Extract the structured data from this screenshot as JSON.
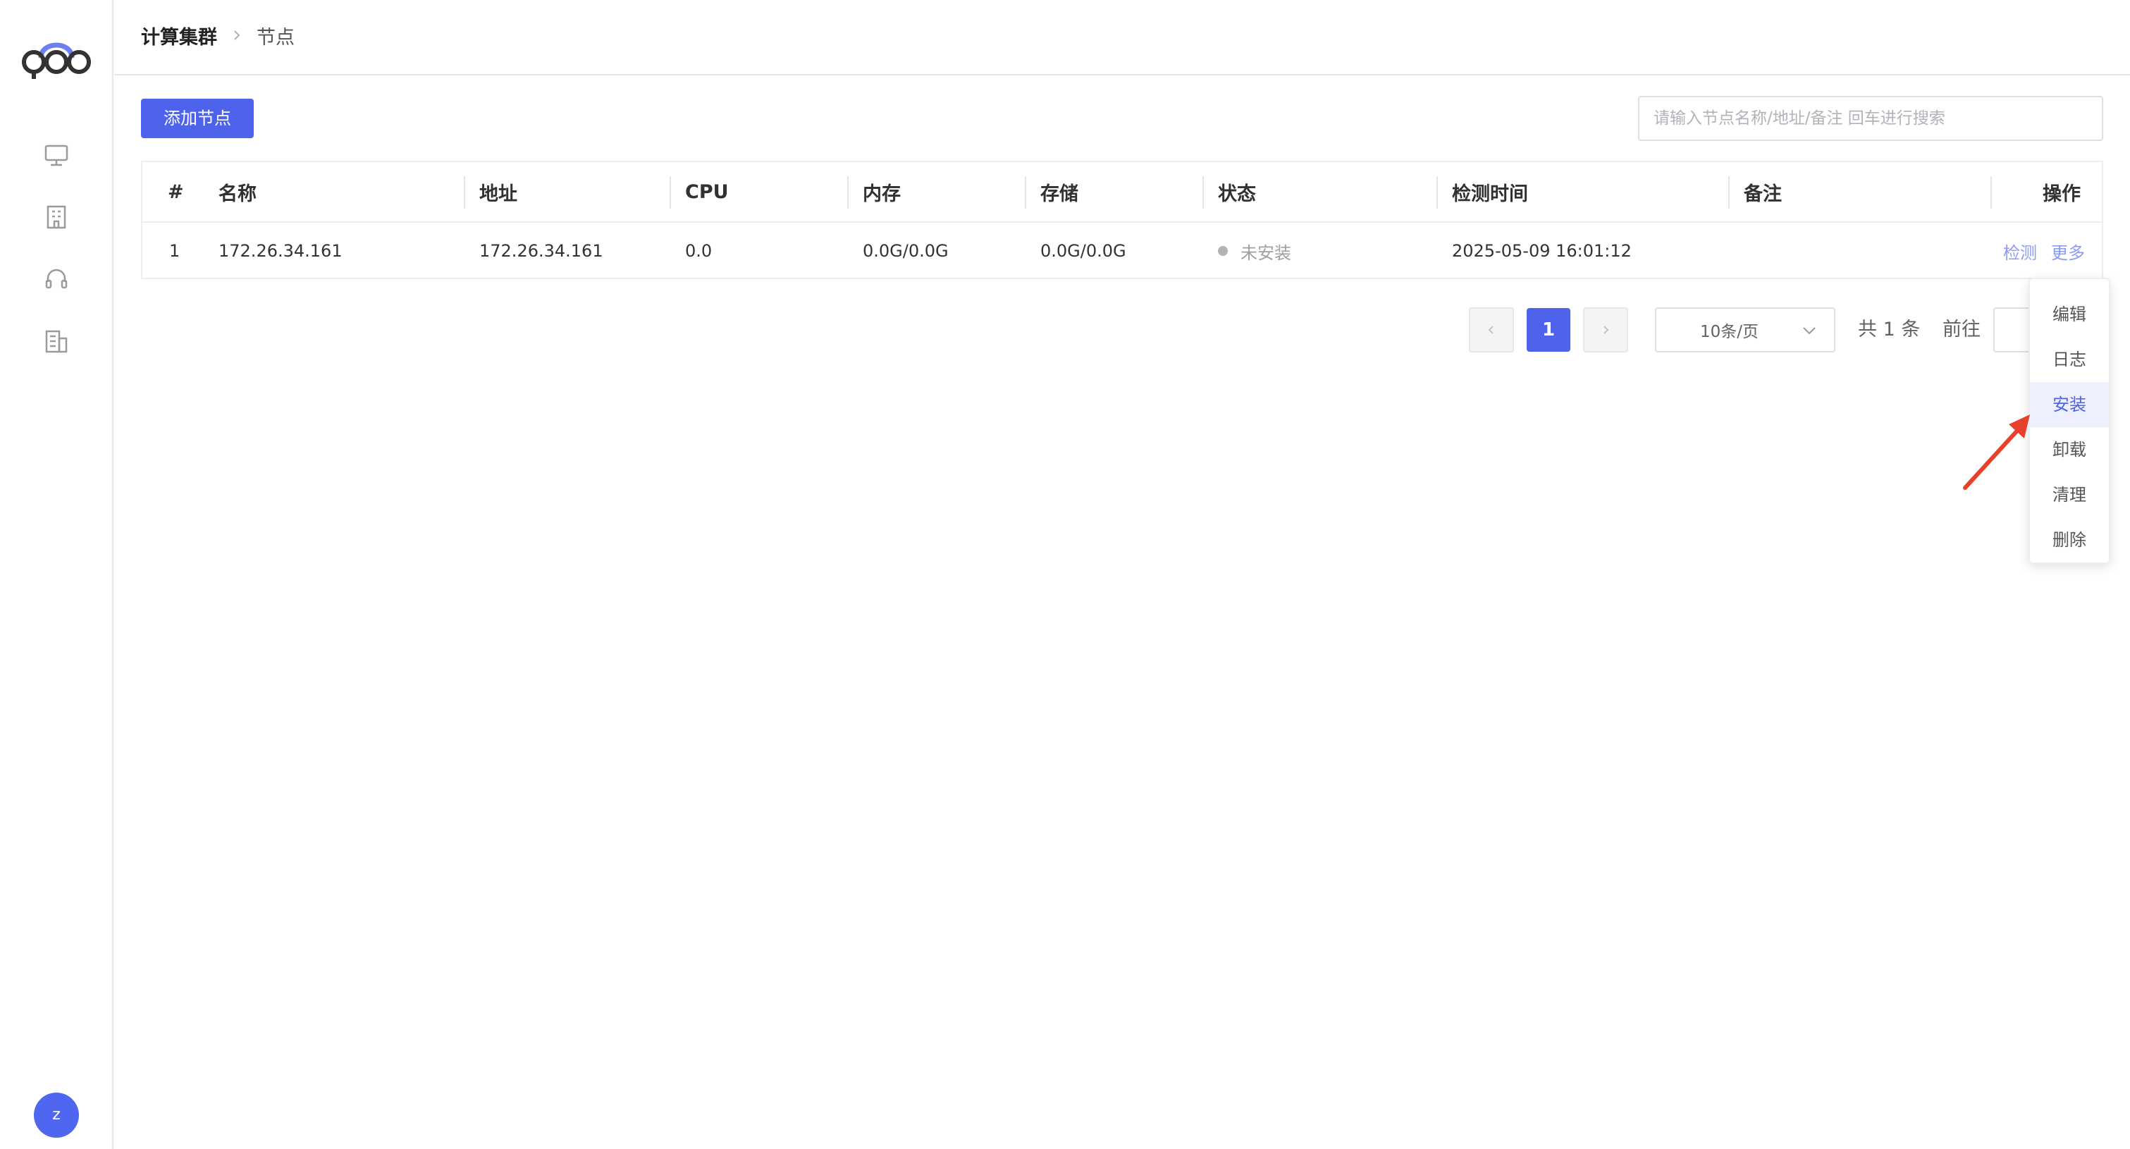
{
  "brand": {
    "accent": "#4e63ec",
    "link": "#8c9bf2",
    "arrow": "#e8412b"
  },
  "sidebar": {
    "items": [
      {
        "icon": "monitor-icon"
      },
      {
        "icon": "building-icon"
      },
      {
        "icon": "headset-icon"
      },
      {
        "icon": "office-icon"
      }
    ],
    "avatar_initial": "z"
  },
  "breadcrumb": {
    "parent": "计算集群",
    "current": "节点"
  },
  "toolbar": {
    "add_label": "添加节点",
    "search_placeholder": "请输入节点名称/地址/备注 回车进行搜索"
  },
  "table": {
    "headers": {
      "index": "#",
      "name": "名称",
      "address": "地址",
      "cpu": "CPU",
      "memory": "内存",
      "storage": "存储",
      "status": "状态",
      "check_time": "检测时间",
      "remark": "备注",
      "actions": "操作"
    },
    "rows": [
      {
        "index": "1",
        "name": "172.26.34.161",
        "address": "172.26.34.161",
        "cpu": "0.0",
        "memory": "0.0G/0.0G",
        "storage": "0.0G/0.0G",
        "status": "未安装",
        "check_time": "2025-05-09 16:01:12",
        "remark": "",
        "action_check": "检测",
        "action_more": "更多"
      }
    ]
  },
  "pagination": {
    "current_page": "1",
    "page_size": "10条/页",
    "total": "共 1 条",
    "goto_label": "前往"
  },
  "more_menu": {
    "items": [
      "编辑",
      "日志",
      "安装",
      "卸载",
      "清理",
      "删除"
    ],
    "active": "安装"
  }
}
